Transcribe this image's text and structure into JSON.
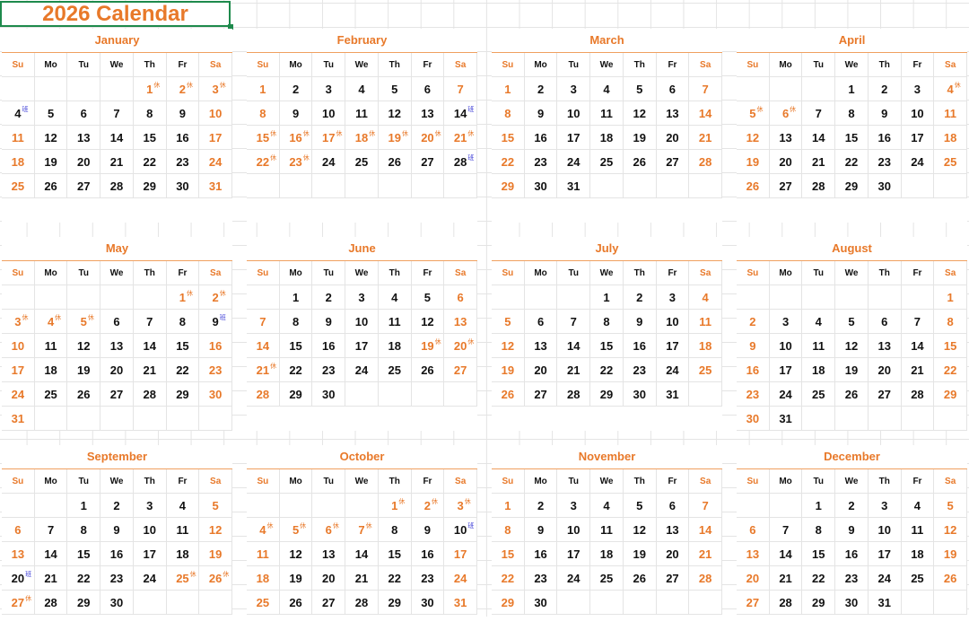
{
  "title": "2026 Calendar",
  "weekday_headers": [
    "Su",
    "Mo",
    "Tu",
    "We",
    "Th",
    "Fr",
    "Sa"
  ],
  "colors": {
    "accent": "#e8792a",
    "workday_mark": "#3b3bd6",
    "selection": "#1e8a4c"
  },
  "rest_mark": "休",
  "work_mark": "班",
  "months": [
    {
      "name": "January",
      "start": 4,
      "days": 31,
      "rest": [
        1,
        2,
        3
      ],
      "work": [
        4
      ]
    },
    {
      "name": "February",
      "start": 0,
      "days": 28,
      "rest": [
        15,
        16,
        17,
        18,
        19,
        20,
        21,
        22,
        23
      ],
      "work": [
        14,
        28
      ]
    },
    {
      "name": "March",
      "start": 0,
      "days": 31,
      "rest": [],
      "work": []
    },
    {
      "name": "April",
      "start": 3,
      "days": 30,
      "rest": [
        4,
        5,
        6
      ],
      "work": []
    },
    {
      "name": "May",
      "start": 5,
      "days": 31,
      "rest": [
        1,
        2,
        3,
        4,
        5
      ],
      "work": [
        9
      ]
    },
    {
      "name": "June",
      "start": 1,
      "days": 30,
      "rest": [
        19,
        20,
        21
      ],
      "work": []
    },
    {
      "name": "July",
      "start": 3,
      "days": 31,
      "rest": [],
      "work": []
    },
    {
      "name": "August",
      "start": 6,
      "days": 31,
      "rest": [],
      "work": []
    },
    {
      "name": "September",
      "start": 2,
      "days": 30,
      "rest": [
        25,
        26,
        27
      ],
      "work": [
        20
      ]
    },
    {
      "name": "October",
      "start": 4,
      "days": 31,
      "rest": [
        1,
        2,
        3,
        4,
        5,
        6,
        7
      ],
      "work": [
        10
      ]
    },
    {
      "name": "November",
      "start": 0,
      "days": 30,
      "rest": [],
      "work": []
    },
    {
      "name": "December",
      "start": 2,
      "days": 31,
      "rest": [],
      "work": []
    }
  ]
}
